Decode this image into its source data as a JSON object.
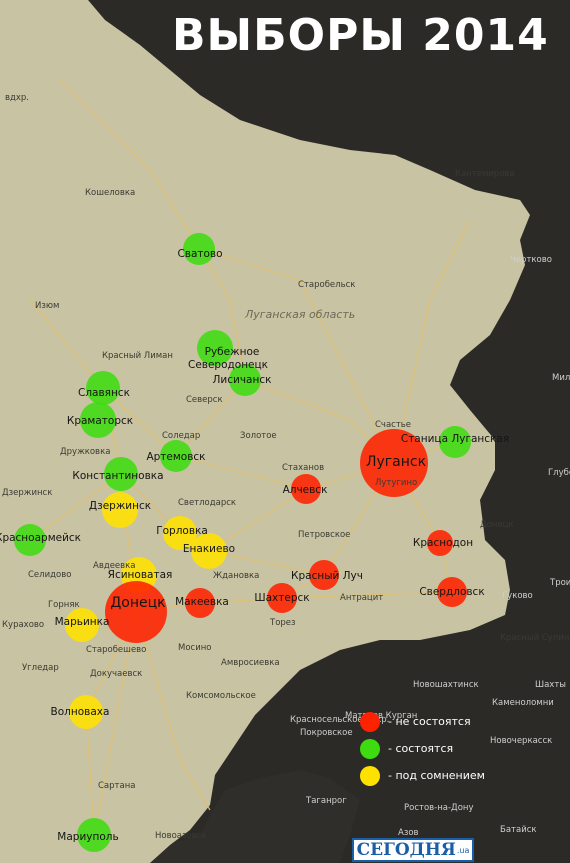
{
  "title": "ВЫБОРЫ 2014",
  "colors": {
    "fail": "#ff2200",
    "ok": "#3ddc10",
    "doubt": "#ffe100",
    "land": "#c9c4a4",
    "dark": "#2b2a27"
  },
  "region_label": "Луганская область",
  "legend": [
    {
      "status": "fail",
      "label": "- не состоятся"
    },
    {
      "status": "ok",
      "label": "- состоятся"
    },
    {
      "status": "doubt",
      "label": "- под сомнением"
    }
  ],
  "logo": {
    "text": "СЕГОДНЯ",
    "suffix": ".ua"
  },
  "cities": [
    {
      "name": "Сватово",
      "status": "ok"
    },
    {
      "name": "Рубежное",
      "status": "ok"
    },
    {
      "name": "Северодонецк",
      "status": "ok"
    },
    {
      "name": "Лисичанск",
      "status": "ok"
    },
    {
      "name": "Славянск",
      "status": "ok"
    },
    {
      "name": "Краматорск",
      "status": "ok"
    },
    {
      "name": "Артемовск",
      "status": "ok"
    },
    {
      "name": "Константиновка",
      "status": "ok"
    },
    {
      "name": "Красноармейск",
      "status": "ok"
    },
    {
      "name": "Станица Луганская",
      "status": "ok"
    },
    {
      "name": "Волноваха",
      "status": "doubt"
    },
    {
      "name": "Мариуполь",
      "status": "ok"
    },
    {
      "name": "Дзержинск",
      "status": "doubt"
    },
    {
      "name": "Горловка",
      "status": "doubt"
    },
    {
      "name": "Енакиево",
      "status": "doubt"
    },
    {
      "name": "Ясиноватая",
      "status": "doubt"
    },
    {
      "name": "Марьинка",
      "status": "doubt"
    },
    {
      "name": "Луганск",
      "status": "fail"
    },
    {
      "name": "Алчевск",
      "status": "fail"
    },
    {
      "name": "Донецк",
      "status": "fail"
    },
    {
      "name": "Макеевка",
      "status": "fail"
    },
    {
      "name": "Шахтерск",
      "status": "fail"
    },
    {
      "name": "Красный Луч",
      "status": "fail"
    },
    {
      "name": "Краснодон",
      "status": "fail"
    },
    {
      "name": "Свердловск",
      "status": "fail"
    }
  ],
  "places": [
    "вдхр.",
    "Кошеловка",
    "Изюм",
    "Красный Лиман",
    "Северск",
    "Соледар",
    "Дружковка",
    "Золотое",
    "Стаханов",
    "Счастье",
    "Петровское",
    "Лутугино",
    "Светлодарск",
    "Авдеевка",
    "Ждановка",
    "Антрацит",
    "Торез",
    "Горняк",
    "Кураxово",
    "Старобешево",
    "Угледар",
    "Мосино",
    "Амвросиевка",
    "Докучаевск",
    "Комсомольское",
    "Сартана",
    "Новоазовск",
    "Селидово",
    "Старобельск",
    "Кантемирова",
    "Чертково",
    "Донецк",
    "Гуково",
    "Шахты",
    "Новошахтинск",
    "Каменоломни",
    "Новочеркасск",
    "Таганрог",
    "Ростов-на-Дону",
    "Батайск",
    "Азов",
    "Покровское",
    "Красносельское вдхр.",
    "Дзержинск",
    "Миллерово",
    "Красный Сулин",
    "Матвеев Курган",
    "Глубокий",
    "Троицкое"
  ]
}
